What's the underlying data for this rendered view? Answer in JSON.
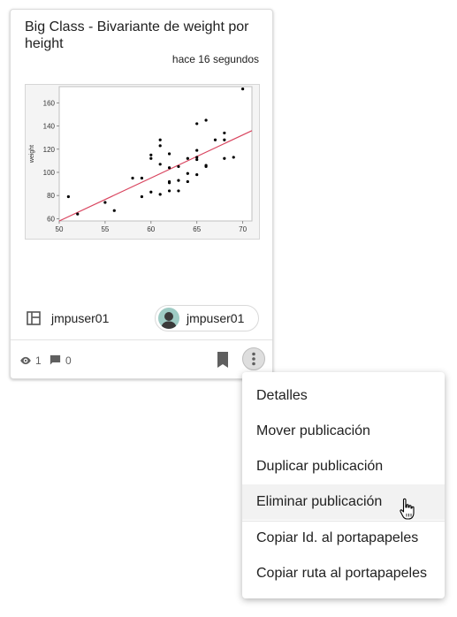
{
  "card": {
    "title": "Big Class - Bivariante de weight por height",
    "time": "hace 16 segundos",
    "space": "jmpuser01",
    "owner": "jmpuser01",
    "views": "1",
    "comments": "0",
    "icons": {
      "space": "space-layout-icon",
      "views": "eye-icon",
      "comments": "comment-icon",
      "bookmark": "bookmark-icon",
      "more": "more-vertical-icon"
    }
  },
  "chart_data": {
    "type": "scatter",
    "ylabel": "weight",
    "xlim": [
      50,
      71
    ],
    "ylim": [
      58,
      174
    ],
    "x_ticks": [
      "50",
      "55",
      "60",
      "65",
      "70"
    ],
    "y_ticks": [
      "60",
      "80",
      "100",
      "120",
      "140",
      "160"
    ],
    "points": [
      [
        51,
        79
      ],
      [
        52,
        64
      ],
      [
        55,
        74
      ],
      [
        56,
        67
      ],
      [
        58,
        95
      ],
      [
        59,
        95
      ],
      [
        59,
        79
      ],
      [
        60,
        83
      ],
      [
        60,
        112
      ],
      [
        60,
        115
      ],
      [
        61,
        81
      ],
      [
        61,
        107
      ],
      [
        61,
        123
      ],
      [
        61,
        128
      ],
      [
        62,
        84
      ],
      [
        62,
        91
      ],
      [
        62,
        92
      ],
      [
        62,
        104
      ],
      [
        62,
        116
      ],
      [
        63,
        84
      ],
      [
        63,
        93
      ],
      [
        63,
        105
      ],
      [
        64,
        92
      ],
      [
        64,
        99
      ],
      [
        64,
        112
      ],
      [
        65,
        98
      ],
      [
        65,
        111
      ],
      [
        65,
        113
      ],
      [
        65,
        119
      ],
      [
        65,
        142
      ],
      [
        66,
        105
      ],
      [
        66,
        106
      ],
      [
        66,
        145
      ],
      [
        67,
        128
      ],
      [
        68,
        112
      ],
      [
        68,
        128
      ],
      [
        68,
        134
      ],
      [
        69,
        113
      ],
      [
        70,
        172
      ]
    ],
    "fit_line": [
      [
        50,
        58
      ],
      [
        71,
        136
      ]
    ],
    "colors": {
      "points": "#000000",
      "fit_line": "#d9455f",
      "background": "#ffffff"
    }
  },
  "menu": {
    "items": [
      "Detalles",
      "Mover publicación",
      "Duplicar publicación",
      "Eliminar publicación",
      "Copiar Id. al portapapeles",
      "Copiar ruta al portapapeles"
    ]
  }
}
